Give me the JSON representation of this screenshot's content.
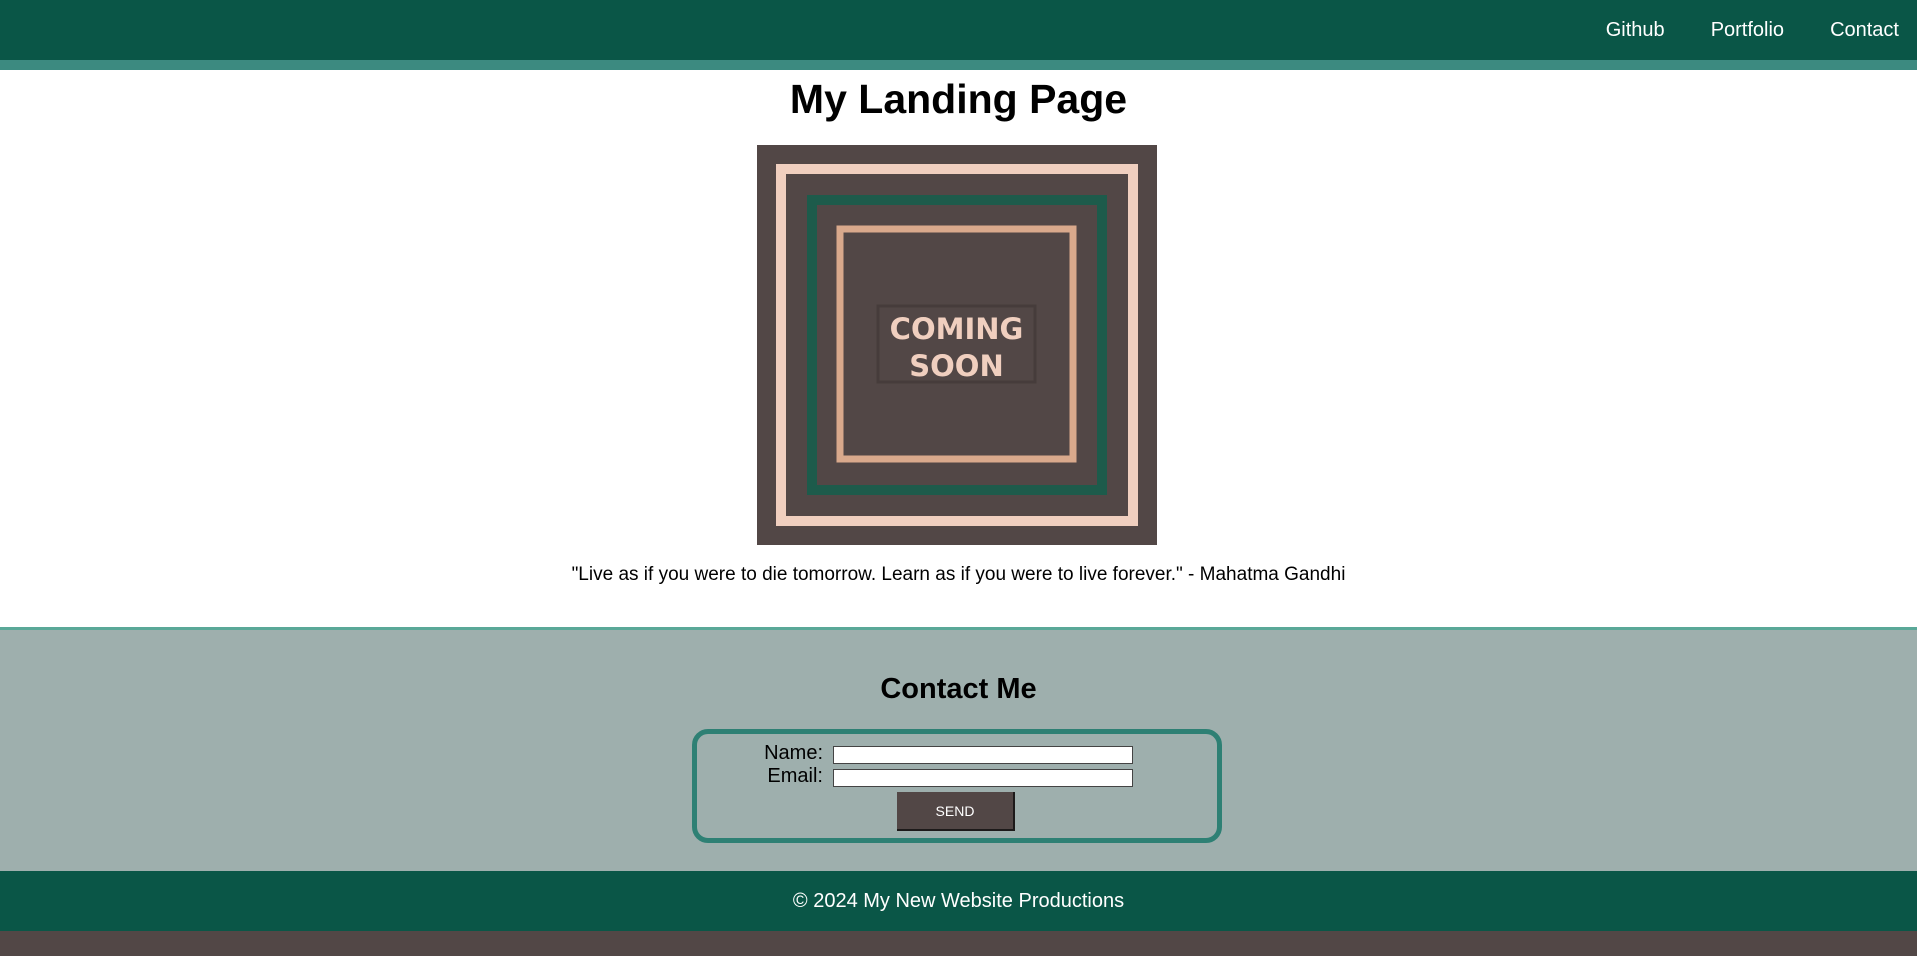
{
  "nav": {
    "links": [
      "Github",
      "Portfolio",
      "Contact"
    ]
  },
  "main": {
    "title": "My Landing Page",
    "hero_image": {
      "caption": "COMING SOON",
      "line1": "COMING",
      "line2": "SOON"
    },
    "quote": "\"Live as if you were to die tomorrow. Learn as if you were to live forever.\" - Mahatma Gandhi"
  },
  "contact": {
    "title": "Contact Me",
    "name_label": "Name:",
    "name_value": "",
    "email_label": "Email:",
    "email_value": "",
    "send_label": "SEND"
  },
  "footer": {
    "text": "© 2024 My New Website Productions"
  },
  "colors": {
    "nav_bg": "#0a5647",
    "nav_stripe": "#3c8a80",
    "contact_bg": "#9eafad",
    "contact_border": "#2e8074",
    "button_bg": "#524746",
    "hero_bg": "#524746",
    "hero_peach": "#f0cfbf",
    "hero_green": "#1d5b4b",
    "hero_tan": "#d9a98c"
  }
}
